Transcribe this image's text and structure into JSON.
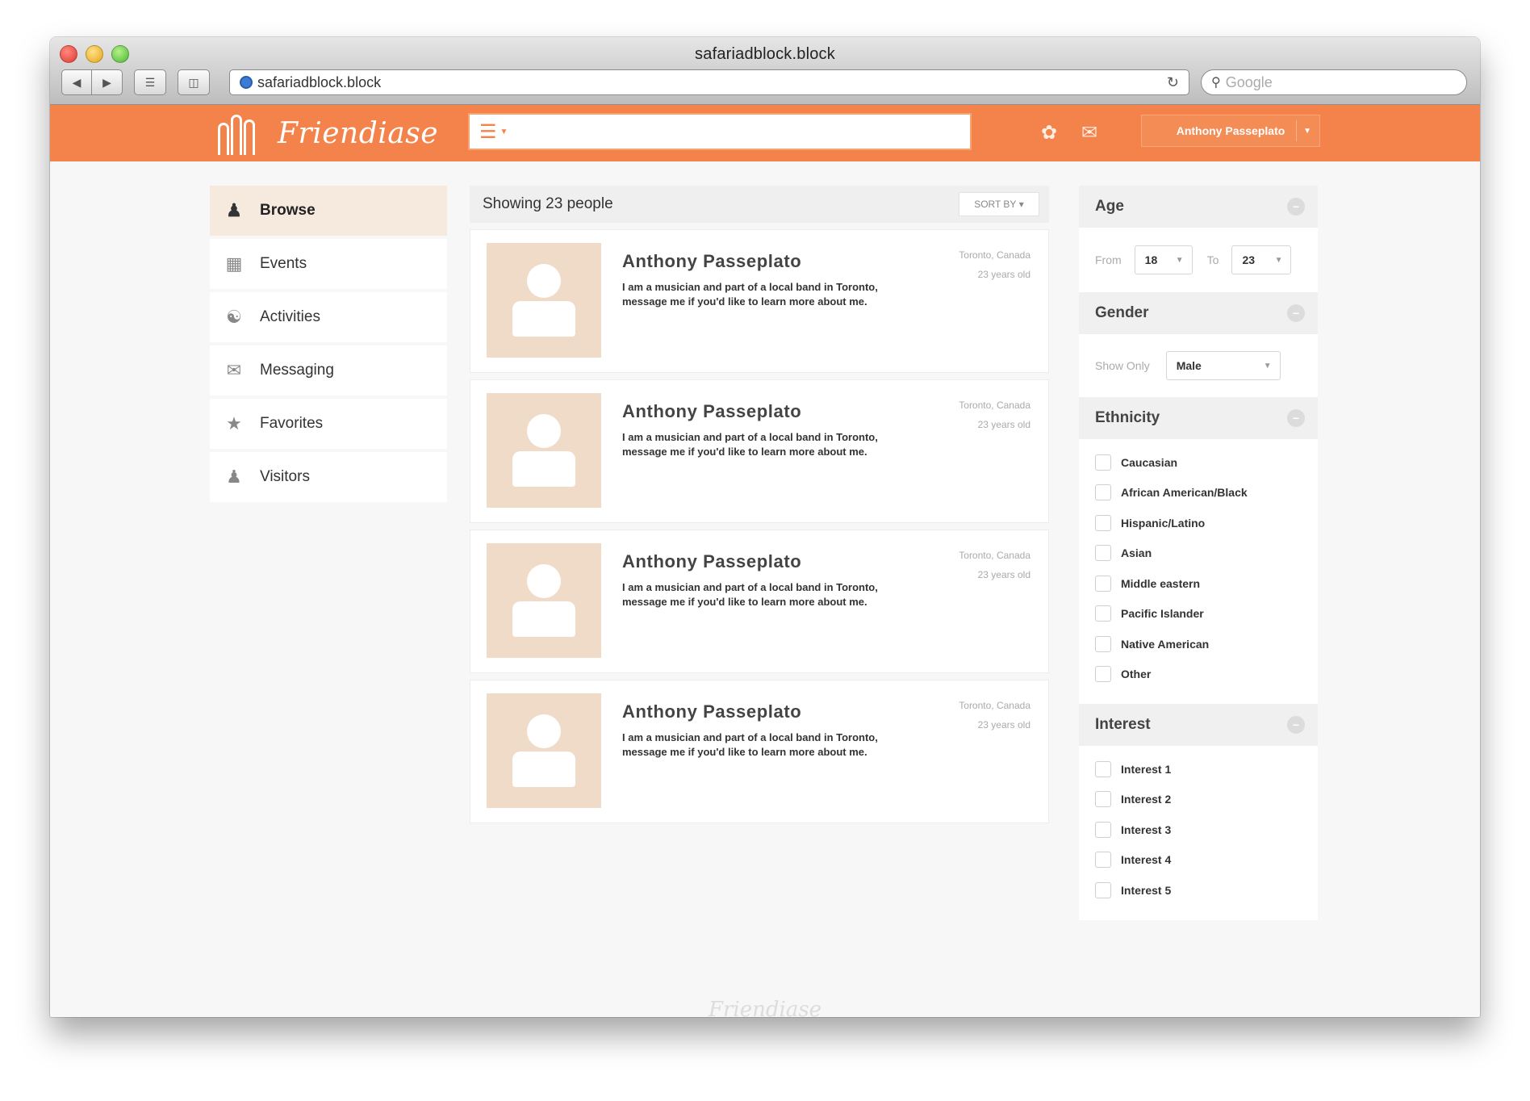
{
  "window": {
    "title": "safariadblock.block",
    "url": "safariadblock.block",
    "search_placeholder": "Google"
  },
  "header": {
    "logo_text": "Friendiase",
    "search_placeholder": "",
    "user_name": "Anthony Passeplato"
  },
  "sidebar": {
    "items": [
      {
        "label": "Browse",
        "icon": "person-icon",
        "glyph": "♟"
      },
      {
        "label": "Events",
        "icon": "calendar-icon",
        "glyph": "▦"
      },
      {
        "label": "Activities",
        "icon": "walking-icon",
        "glyph": "☸"
      },
      {
        "label": "Messaging",
        "icon": "envelope-icon",
        "glyph": "✉"
      },
      {
        "label": "Favorites",
        "icon": "star-icon",
        "glyph": "★"
      },
      {
        "label": "Visitors",
        "icon": "people-icon",
        "glyph": "♟"
      }
    ]
  },
  "results": {
    "heading": "Showing 23 people",
    "sort_label": "SORT BY",
    "people": [
      {
        "name": "Anthony Passeplato",
        "bio": "I am a musician and part of a local band in Toronto, message me if you'd like to learn more about me.",
        "location": "Toronto, Canada",
        "age": "23 years old"
      },
      {
        "name": "Anthony Passeplato",
        "bio": "I am a musician and part of a local band in Toronto, message me if you'd like to learn more about me.",
        "location": "Toronto, Canada",
        "age": "23 years old"
      },
      {
        "name": "Anthony Passeplato",
        "bio": "I am a musician and part of a local band in Toronto, message me if you'd like to learn more about me.",
        "location": "Toronto, Canada",
        "age": "23 years old"
      },
      {
        "name": "Anthony Passeplato",
        "bio": "I am a musician and part of a local band in Toronto, message me if you'd like to learn more about me.",
        "location": "Toronto, Canada",
        "age": "23 years old"
      }
    ]
  },
  "filters": {
    "age": {
      "title": "Age",
      "from_label": "From",
      "from_value": "18",
      "to_label": "To",
      "to_value": "23"
    },
    "gender": {
      "title": "Gender",
      "show_only_label": "Show Only",
      "value": "Male"
    },
    "ethnicity": {
      "title": "Ethnicity",
      "options": [
        "Caucasian",
        "African American/Black",
        "Hispanic/Latino",
        "Asian",
        "Middle eastern",
        "Pacific Islander",
        "Native American",
        "Other"
      ]
    },
    "interest": {
      "title": "Interest",
      "options": [
        "Interest 1",
        "Interest 2",
        "Interest 3",
        "Interest 4",
        "Interest 5"
      ]
    }
  },
  "footer": {
    "brand": "Friendiase"
  },
  "colors": {
    "accent": "#f3834a",
    "avatar_bg": "#f0dbc9",
    "active_nav": "#f6e9de"
  }
}
